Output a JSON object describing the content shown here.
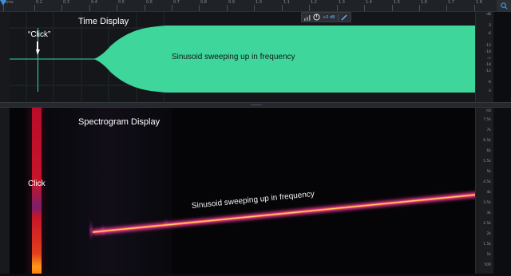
{
  "ruler": {
    "ticks": [
      "hms",
      "0.2",
      "0.3",
      "0.4",
      "0.5",
      "0.6",
      "0.7",
      "0.8",
      "0.9",
      "1.0",
      "1.1",
      "1.2",
      "1.3",
      "1.4",
      "1.5",
      "1.6",
      "1.7",
      "1.8"
    ]
  },
  "hud": {
    "gain": "+0 dB"
  },
  "time_panel": {
    "title": "Time Display",
    "click_label": "“Click”",
    "sweep_label": "Sinusoid sweeping up in frequency",
    "scale_unit": "dB",
    "scale_labels": [
      "-3",
      "-6",
      "-12",
      "-18",
      "-∞",
      "-18",
      "-12",
      "-6",
      "-3"
    ]
  },
  "spectrogram_panel": {
    "title": "Spectrogram Display",
    "click_label": "Click",
    "sweep_label": "Sinusoid sweeping up in frequency",
    "scale_unit": "Hz",
    "scale_labels": [
      "7.5k",
      "7k",
      "6.5k",
      "6k",
      "5.5k",
      "5k",
      "4.5k",
      "4k",
      "3.5k",
      "3k",
      "2.5k",
      "2k",
      "1.5k",
      "1k",
      "500"
    ]
  },
  "colors": {
    "waveform": "#3fd69b",
    "accent": "#3e8ede",
    "sweep_core": "#ffd07a",
    "sweep_glow": "#ff3aa0",
    "click_red": "#b80d2a"
  }
}
